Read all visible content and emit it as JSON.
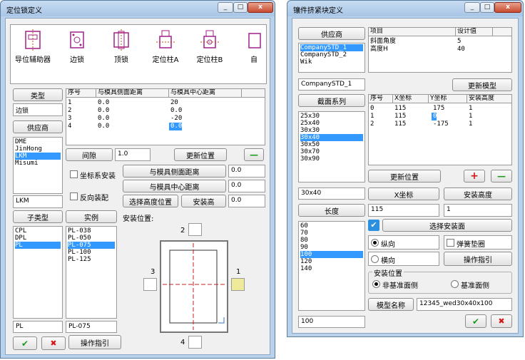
{
  "win1": {
    "title": "定位锁定义",
    "titlebar_buttons": [
      "_",
      "□",
      "x"
    ],
    "icons": [
      {
        "icon": "guide-assist-icon",
        "label": "导位辅助器"
      },
      {
        "icon": "side-lock-icon",
        "label": "边锁"
      },
      {
        "icon": "top-lock-icon",
        "label": "顶锁"
      },
      {
        "icon": "locating-pin-a-icon",
        "label": "定位柱A"
      },
      {
        "icon": "locating-pin-b-icon",
        "label": "定位柱B"
      },
      {
        "icon": "partial-icon",
        "label": "自"
      }
    ],
    "type_button": "类型",
    "type_value": "边锁",
    "supplier_button": "供应商",
    "suppliers": [
      "DME",
      "JinHong",
      "LKM",
      "Misumi"
    ],
    "supplier_selected": 2,
    "supplier_value": "LKM",
    "subtype_button": "子类型",
    "subtypes": [
      "CPL",
      "DPL",
      "PL"
    ],
    "subtype_selected": 2,
    "subtype_value": "PL",
    "instance_button": "实例",
    "instances": [
      "PL-038",
      "PL-050",
      "PL-075",
      "PL-100",
      "PL-125"
    ],
    "instance_selected": 2,
    "instance_value": "PL-075",
    "table_headers": [
      "序号",
      "与模具侧面距离",
      "与模具中心距离"
    ],
    "table_rows": [
      [
        "1",
        "0.0",
        "20"
      ],
      [
        "2",
        "0.0",
        "0.0"
      ],
      [
        "3",
        "0.0",
        "-20"
      ],
      [
        "4",
        "0.0",
        "0.0"
      ]
    ],
    "gap_button": "间隙",
    "gap_value": "1.0",
    "update_position_button": "更新位置",
    "minus_symbol": "—",
    "coord_install_label": "坐标系安装",
    "reverse_assembly_label": "反向装配",
    "side_distance_button": "与模具侧面距离",
    "side_distance_value": "0.0",
    "center_distance_button": "与模具中心距离",
    "center_distance_value": "0.0",
    "select_height_button": "选择高度位置",
    "install_height_button": "安装高",
    "install_height_value": "0.0",
    "install_position_label": "安装位置:",
    "position_labels": [
      "1",
      "2",
      "3",
      "4"
    ],
    "ok_symbol": "✔",
    "cancel_symbol": "✖",
    "guide_button": "操作指引"
  },
  "win2": {
    "title": "镶件挤紧块定义",
    "titlebar_buttons": [
      "_",
      "□",
      "x"
    ],
    "supplier_button": "供应商",
    "suppliers": [
      "CompanySTD_1",
      "CompanySTD_2",
      "Wik"
    ],
    "supplier_selected": 0,
    "supplier_value": "CompanySTD_1",
    "param_headers": [
      "项目",
      "设计值"
    ],
    "param_rows": [
      [
        "斜面角度",
        "5"
      ],
      [
        "高度H",
        "40"
      ]
    ],
    "update_model_button": "更新模型",
    "section_button": "截面系列",
    "sections": [
      "25x30",
      "25x40",
      "30x30",
      "30x40",
      "30x50",
      "30x70",
      "30x90"
    ],
    "section_selected": 3,
    "section_value": "30x40",
    "pos_headers": [
      "序号",
      "X坐标",
      "Y坐标",
      "安装高度"
    ],
    "pos_rows": [
      [
        "0",
        "115",
        "175",
        "1"
      ],
      [
        "1",
        "115",
        "0",
        "1"
      ],
      [
        "2",
        "115",
        "-175",
        "1"
      ]
    ],
    "update_position_button": "更新位置",
    "plus_symbol": "+",
    "minus_symbol": "—",
    "x_coord_button": "X坐标",
    "install_height_button": "安装高度",
    "x_coord_value": "115",
    "install_height_value": "1",
    "length_button": "长度",
    "lengths": [
      "60",
      "70",
      "80",
      "90",
      "100",
      "120",
      "140"
    ],
    "length_selected": 4,
    "length_value": "100",
    "select_install_face_button": "选择安装面",
    "vertical_label": "纵向",
    "spring_pad_label": "弹簧垫圈",
    "horizontal_label": "横向",
    "guide_button": "操作指引",
    "install_position_group": "安装位置",
    "non_reference_label": "非基准面侧",
    "reference_label": "基准面侧",
    "model_name_button": "模型名称",
    "model_name_value": "12345_wed30x40x100",
    "ok_symbol": "✔",
    "cancel_symbol": "✖"
  },
  "colors": {
    "selection": "#3399ff",
    "ok_green": "#1f9a1f",
    "cancel_red": "#d01818",
    "highlight_square": "#eeea9a"
  }
}
